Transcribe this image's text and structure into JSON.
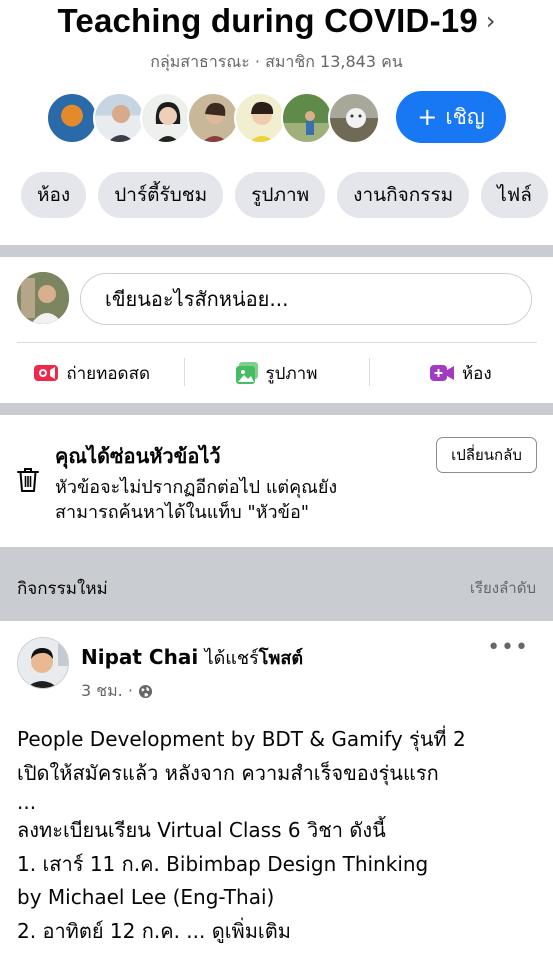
{
  "group": {
    "title": "Teaching during COVID-19",
    "chevron": "›",
    "meta": "กลุ่มสาธารณะ · สมาชิก 13,843 คน",
    "invite_label": "เชิญ",
    "invite_plus": "+"
  },
  "tabs": [
    {
      "label": "ห้อง"
    },
    {
      "label": "ปาร์ตี้รับชม"
    },
    {
      "label": "รูปภาพ"
    },
    {
      "label": "งานกิจกรรม"
    },
    {
      "label": "ไฟล์"
    }
  ],
  "composer": {
    "placeholder": "เขียนอะไรสักหน่อย...",
    "actions": [
      {
        "label": "ถ่ายทอดสด",
        "icon": "live-video-icon",
        "color": "#f02849"
      },
      {
        "label": "รูปภาพ",
        "icon": "photo-icon",
        "color": "#45bd62"
      },
      {
        "label": "ห้อง",
        "icon": "room-video-icon",
        "color": "#a33bc2"
      }
    ]
  },
  "hidden_notice": {
    "title": "คุณได้ซ่อนหัวข้อไว้",
    "body_line1": "หัวข้อจะไม่ปรากฏอีกต่อไป แต่คุณยัง",
    "body_line2": "สามารถค้นหาได้ในแท็บ \"หัวข้อ\"",
    "undo_label": "เปลี่ยนกลับ"
  },
  "section": {
    "title": "กิจกรรมใหม่",
    "sort_label": "เรียงลำดับ"
  },
  "post": {
    "author": "Nipat Chai",
    "action_prefix": "ได้แชร์",
    "action_bold": "โพสต์",
    "time": "3 ชม. ·",
    "more": "•••",
    "lines": [
      "People Development by BDT & Gamify รุ่นที่ 2",
      "เปิดให้สมัครแล้ว หลังจาก ความสำเร็จของรุ่นแรก",
      "...",
      "ลงทะเบียนเรียน Virtual Class 6 วิชา ดังนี้",
      "1. เสาร์ 11 ก.ค. Bibimbap Design Thinking",
      "by Michael Lee (Eng-Thai)",
      "2. อาทิตย์ 12 ก.ค. ..."
    ],
    "see_more": "ดูเพิ่มเติม"
  },
  "colors": {
    "accent": "#1877f2",
    "divider": "#c9ccd1",
    "chip": "#e4e6eb"
  }
}
